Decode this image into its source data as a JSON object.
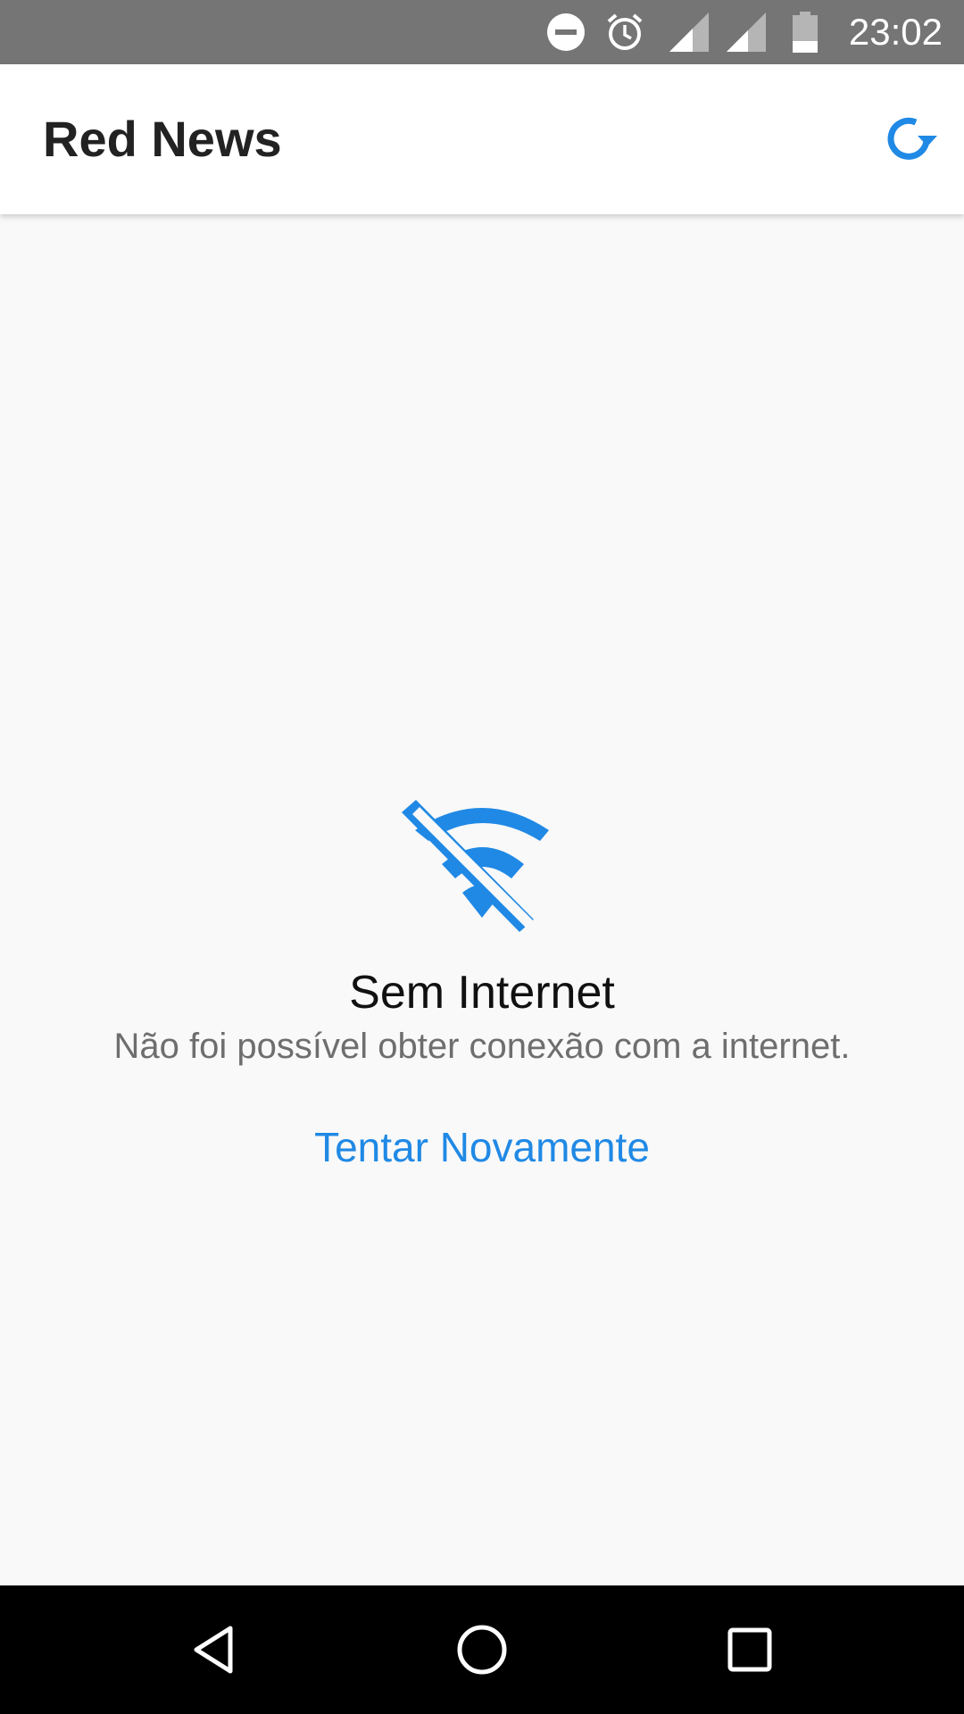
{
  "status_bar": {
    "time": "23:02",
    "icons": [
      "do-not-disturb-icon",
      "alarm-icon",
      "signal-icon",
      "signal-icon",
      "battery-icon"
    ]
  },
  "app_bar": {
    "title": "Red News",
    "refresh_icon": "refresh-icon"
  },
  "error_state": {
    "icon": "wifi-off-icon",
    "title": "Sem Internet",
    "message": "Não foi possível obter conexão com a internet.",
    "retry_label": "Tentar Novamente"
  },
  "nav_bar": {
    "buttons": [
      "back-icon",
      "home-icon",
      "recents-icon"
    ]
  },
  "colors": {
    "accent": "#2089e5",
    "status_bar": "#757575",
    "nav_bar": "#000000",
    "background": "#f9f9f9"
  }
}
